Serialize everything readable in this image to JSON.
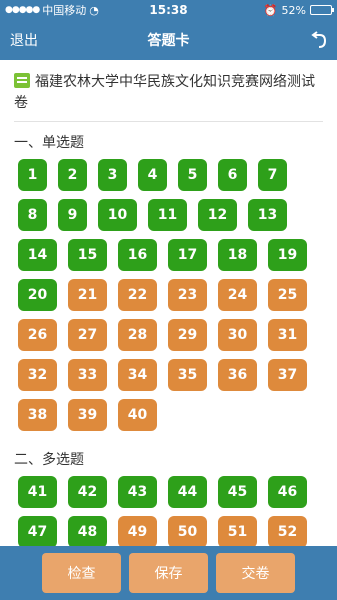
{
  "status_bar": {
    "carrier": "中国移动",
    "time": "15:38",
    "battery": "52%",
    "battery_level": 0.52
  },
  "nav": {
    "back_label": "退出",
    "title": "答题卡",
    "refresh_icon": "refresh-icon"
  },
  "paper": {
    "title": "福建农林大学中华民族文化知识竞赛网络测试卷"
  },
  "sections": [
    {
      "title": "一、单选题",
      "questions": [
        {
          "n": "1",
          "status": "answered"
        },
        {
          "n": "2",
          "status": "answered"
        },
        {
          "n": "3",
          "status": "answered"
        },
        {
          "n": "4",
          "status": "answered"
        },
        {
          "n": "5",
          "status": "answered"
        },
        {
          "n": "6",
          "status": "answered"
        },
        {
          "n": "7",
          "status": "answered"
        },
        {
          "n": "8",
          "status": "answered"
        },
        {
          "n": "9",
          "status": "answered"
        },
        {
          "n": "10",
          "status": "answered"
        },
        {
          "n": "11",
          "status": "answered"
        },
        {
          "n": "12",
          "status": "answered"
        },
        {
          "n": "13",
          "status": "answered"
        },
        {
          "n": "14",
          "status": "answered"
        },
        {
          "n": "15",
          "status": "answered"
        },
        {
          "n": "16",
          "status": "answered"
        },
        {
          "n": "17",
          "status": "answered"
        },
        {
          "n": "18",
          "status": "answered"
        },
        {
          "n": "19",
          "status": "answered"
        },
        {
          "n": "20",
          "status": "answered"
        },
        {
          "n": "21",
          "status": "unanswered"
        },
        {
          "n": "22",
          "status": "unanswered"
        },
        {
          "n": "23",
          "status": "unanswered"
        },
        {
          "n": "24",
          "status": "unanswered"
        },
        {
          "n": "25",
          "status": "unanswered"
        },
        {
          "n": "26",
          "status": "unanswered"
        },
        {
          "n": "27",
          "status": "unanswered"
        },
        {
          "n": "28",
          "status": "unanswered"
        },
        {
          "n": "29",
          "status": "unanswered"
        },
        {
          "n": "30",
          "status": "unanswered"
        },
        {
          "n": "31",
          "status": "unanswered"
        },
        {
          "n": "32",
          "status": "unanswered"
        },
        {
          "n": "33",
          "status": "unanswered"
        },
        {
          "n": "34",
          "status": "unanswered"
        },
        {
          "n": "35",
          "status": "unanswered"
        },
        {
          "n": "36",
          "status": "unanswered"
        },
        {
          "n": "37",
          "status": "unanswered"
        },
        {
          "n": "38",
          "status": "unanswered"
        },
        {
          "n": "39",
          "status": "unanswered"
        },
        {
          "n": "40",
          "status": "unanswered"
        }
      ]
    },
    {
      "title": "二、多选题",
      "questions": [
        {
          "n": "41",
          "status": "answered"
        },
        {
          "n": "42",
          "status": "answered"
        },
        {
          "n": "43",
          "status": "answered"
        },
        {
          "n": "44",
          "status": "answered"
        },
        {
          "n": "45",
          "status": "answered"
        },
        {
          "n": "46",
          "status": "answered"
        },
        {
          "n": "47",
          "status": "answered"
        },
        {
          "n": "48",
          "status": "answered"
        },
        {
          "n": "49",
          "status": "unanswered"
        },
        {
          "n": "50",
          "status": "unanswered"
        },
        {
          "n": "51",
          "status": "unanswered"
        },
        {
          "n": "52",
          "status": "unanswered"
        }
      ]
    }
  ],
  "bottom_bar": {
    "check_label": "检查",
    "save_label": "保存",
    "submit_label": "交卷"
  },
  "colors": {
    "primary": "#3e7eb0",
    "answered": "#2ea01a",
    "unanswered": "#de8a3c",
    "bottom_button": "#e9a56b"
  }
}
